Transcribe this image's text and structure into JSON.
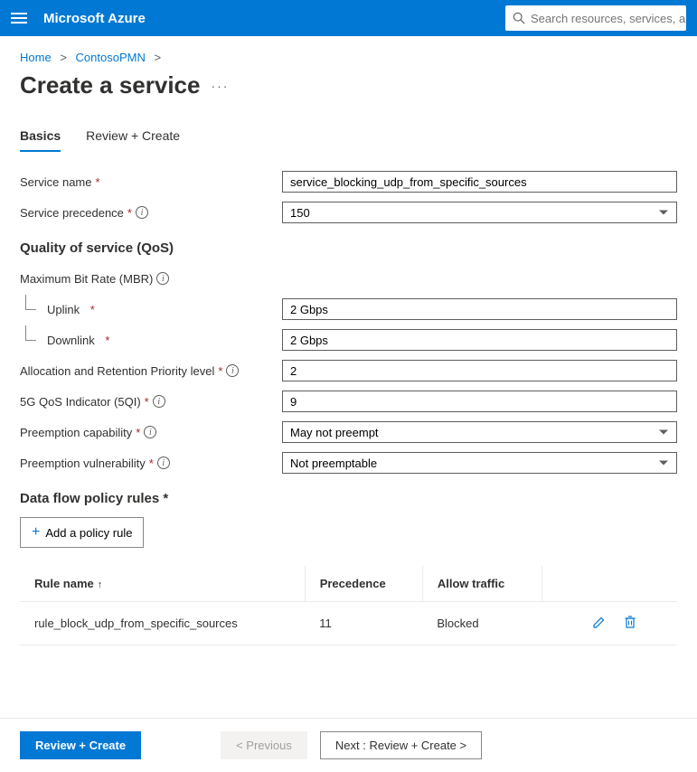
{
  "header": {
    "brand": "Microsoft Azure",
    "search_placeholder": "Search resources, services, and docs"
  },
  "breadcrumb": {
    "items": [
      "Home",
      "ContosoPMN"
    ]
  },
  "page_title": "Create a service",
  "tabs": [
    {
      "label": "Basics",
      "active": true
    },
    {
      "label": "Review + Create",
      "active": false
    }
  ],
  "form": {
    "service_name": {
      "label": "Service name",
      "value": "service_blocking_udp_from_specific_sources",
      "required": true
    },
    "service_precedence": {
      "label": "Service precedence",
      "value": "150",
      "required": true,
      "info": true
    },
    "qos_heading": "Quality of service (QoS)",
    "mbr": {
      "label": "Maximum Bit Rate (MBR)",
      "info": true
    },
    "uplink": {
      "label": "Uplink",
      "value": "2 Gbps",
      "required": true
    },
    "downlink": {
      "label": "Downlink",
      "value": "2 Gbps",
      "required": true
    },
    "arp": {
      "label": "Allocation and Retention Priority level",
      "value": "2",
      "required": true,
      "info": true
    },
    "qi": {
      "label": "5G QoS Indicator (5QI)",
      "value": "9",
      "required": true,
      "info": true
    },
    "preempt_cap": {
      "label": "Preemption capability",
      "value": "May not preempt",
      "required": true,
      "info": true
    },
    "preempt_vul": {
      "label": "Preemption vulnerability",
      "value": "Not preemptable",
      "required": true,
      "info": true
    },
    "rules_heading": "Data flow policy rules",
    "rules_required": true,
    "add_rule_label": "Add a policy rule"
  },
  "rules_table": {
    "columns": [
      "Rule name",
      "Precedence",
      "Allow traffic",
      ""
    ],
    "rows": [
      {
        "name": "rule_block_udp_from_specific_sources",
        "precedence": "11",
        "allow": "Blocked"
      }
    ]
  },
  "footer": {
    "review": "Review + Create",
    "previous": "< Previous",
    "next": "Next : Review + Create >"
  }
}
